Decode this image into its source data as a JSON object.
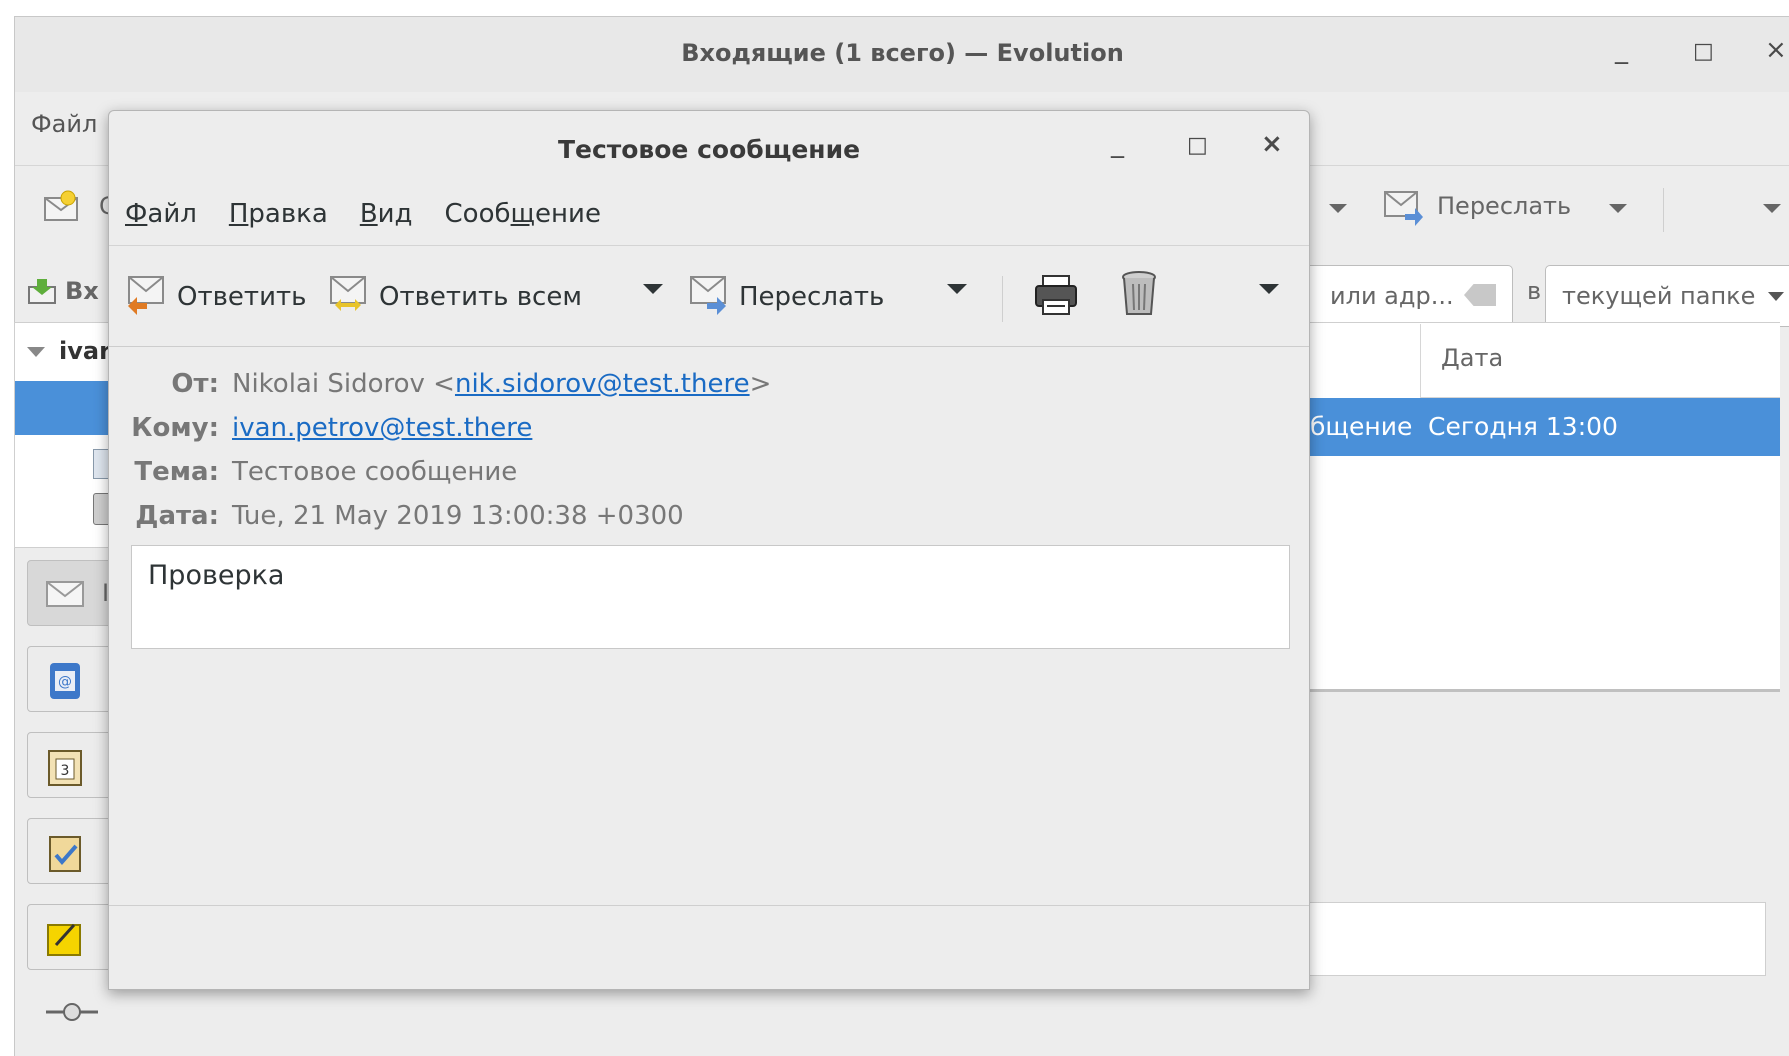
{
  "main_window": {
    "title": "Входящие (1 всего) — Evolution",
    "minimize_glyph": "_",
    "maximize_glyph": "□",
    "close_glyph": "×",
    "menu_file": "Файл",
    "toolbar_new_fragment": "С",
    "toolbar_forward": "Переслать",
    "inbox_fragment": "Вх",
    "account_fragment": "ivar",
    "search_placeholder_fragment": "или адр...",
    "search_in_label": "в",
    "search_scope": "текущей папке",
    "column_date": "Дата",
    "message_subject_fragment": "бщение",
    "message_date": "Сегодня 13:00",
    "switcher_fragment": "I"
  },
  "dialog": {
    "title": "Тестовое сообщение",
    "minimize_glyph": "_",
    "maximize_glyph": "□",
    "close_glyph": "×",
    "menu": {
      "file": {
        "underline": "Ф",
        "rest": "айл"
      },
      "edit": {
        "underline": "П",
        "rest": "равка"
      },
      "view": {
        "underline": "В",
        "rest": "ид"
      },
      "message": {
        "before": "Сооб",
        "underline": "щ",
        "rest": "ение"
      }
    },
    "toolbar": {
      "reply": "Ответить",
      "reply_all": "Ответить всем",
      "forward": "Переслать"
    },
    "headers": {
      "from_label": "От:",
      "from_name": "Nikolai Sidorov <",
      "from_email": "nik.sidorov@test.there",
      "from_close": ">",
      "to_label": "Кому:",
      "to_email": "ivan.petrov@test.there",
      "subject_label": "Тема:",
      "subject": "Тестовое сообщение",
      "date_label": "Дата:",
      "date": "Tue, 21 May 2019 13:00:38 +0300"
    },
    "body": "Проверка"
  },
  "colors": {
    "accent": "#4a90d9",
    "link": "#1a6bc4",
    "window_bg": "#ededed"
  }
}
